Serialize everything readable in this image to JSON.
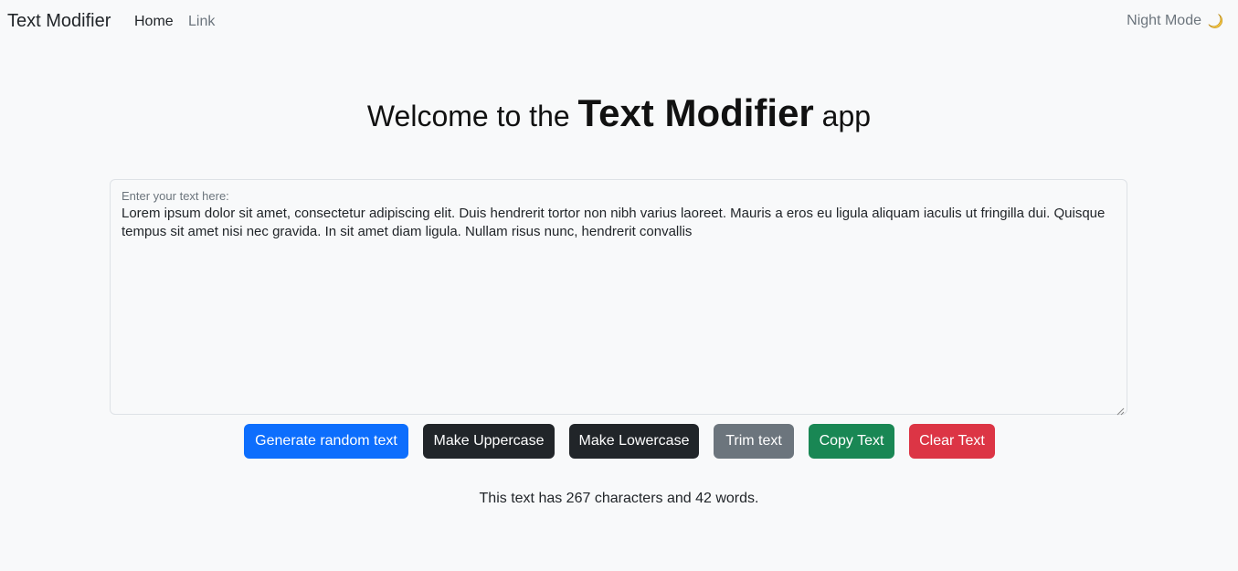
{
  "navbar": {
    "brand": "Text Modifier",
    "links": [
      "Home",
      "Link"
    ],
    "night_mode_label": "Night Mode",
    "night_mode_icon": "moon-icon"
  },
  "heading": {
    "prefix": "Welcome to the",
    "emphasis": "Text Modifier",
    "suffix": "app"
  },
  "editor": {
    "label": "Enter your text here:",
    "value": "Lorem ipsum dolor sit amet, consectetur adipiscing elit. Duis hendrerit tortor non nibh varius laoreet. Mauris a eros eu ligula aliquam iaculis ut fringilla dui. Quisque tempus sit amet nisi nec gravida. In sit amet diam ligula. Nullam risus nunc, hendrerit convallis"
  },
  "buttons": {
    "generate": "Generate random text",
    "uppercase": "Make Uppercase",
    "lowercase": "Make Lowercase",
    "trim": "Trim text",
    "copy": "Copy Text",
    "clear": "Clear Text"
  },
  "colors": {
    "primary": "#0d6efd",
    "dark": "#212529",
    "secondary": "#6c757d",
    "success": "#198754",
    "danger": "#dc3545",
    "background": "#f8f9fa"
  },
  "summary": "This text has 267 characters and 42 words."
}
